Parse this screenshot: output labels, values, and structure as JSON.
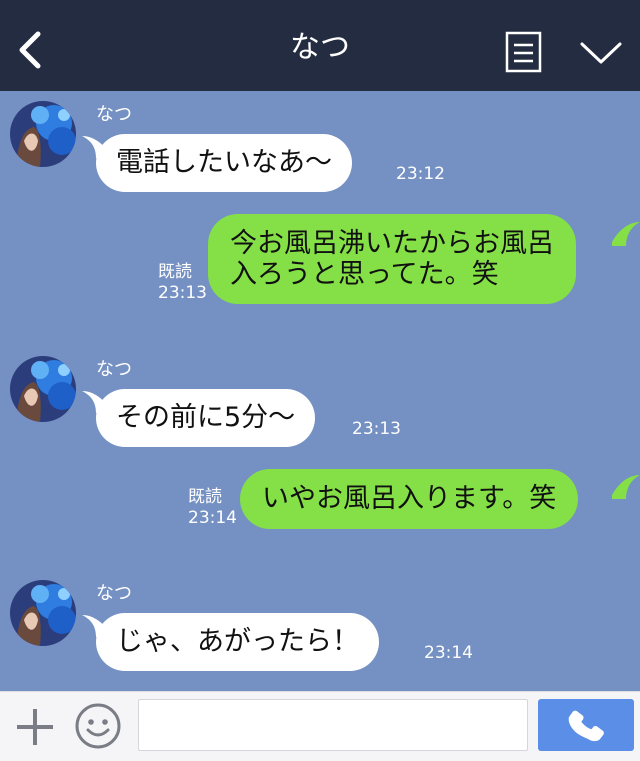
{
  "header": {
    "title": "なつ"
  },
  "contact": {
    "name": "なつ"
  },
  "messages": [
    {
      "side": "in",
      "sender": "なつ",
      "text": "電話したいなあ〜",
      "time": "23:12"
    },
    {
      "side": "out",
      "lines": [
        "今お風呂沸いたからお風呂",
        "入ろうと思ってた。笑"
      ],
      "read": "既読",
      "time": "23:13"
    },
    {
      "side": "in",
      "sender": "なつ",
      "text": "その前に5分〜",
      "time": "23:13"
    },
    {
      "side": "out",
      "text": "いやお風呂入ります。笑",
      "read": "既読",
      "time": "23:14"
    },
    {
      "side": "in",
      "sender": "なつ",
      "text": "じゃ、あがったら！",
      "time": "23:14"
    }
  ],
  "footer": {
    "input_value": "",
    "input_placeholder": ""
  },
  "colors": {
    "header_bg": "#232c41",
    "chat_bg": "#7591c3",
    "outgoing_bubble": "#84e046",
    "incoming_bubble": "#ffffff",
    "call_button": "#5b8ee6"
  },
  "icons": [
    "back-arrow-icon",
    "menu-list-icon",
    "chevron-down-icon",
    "plus-icon",
    "emoji-icon",
    "phone-icon"
  ]
}
